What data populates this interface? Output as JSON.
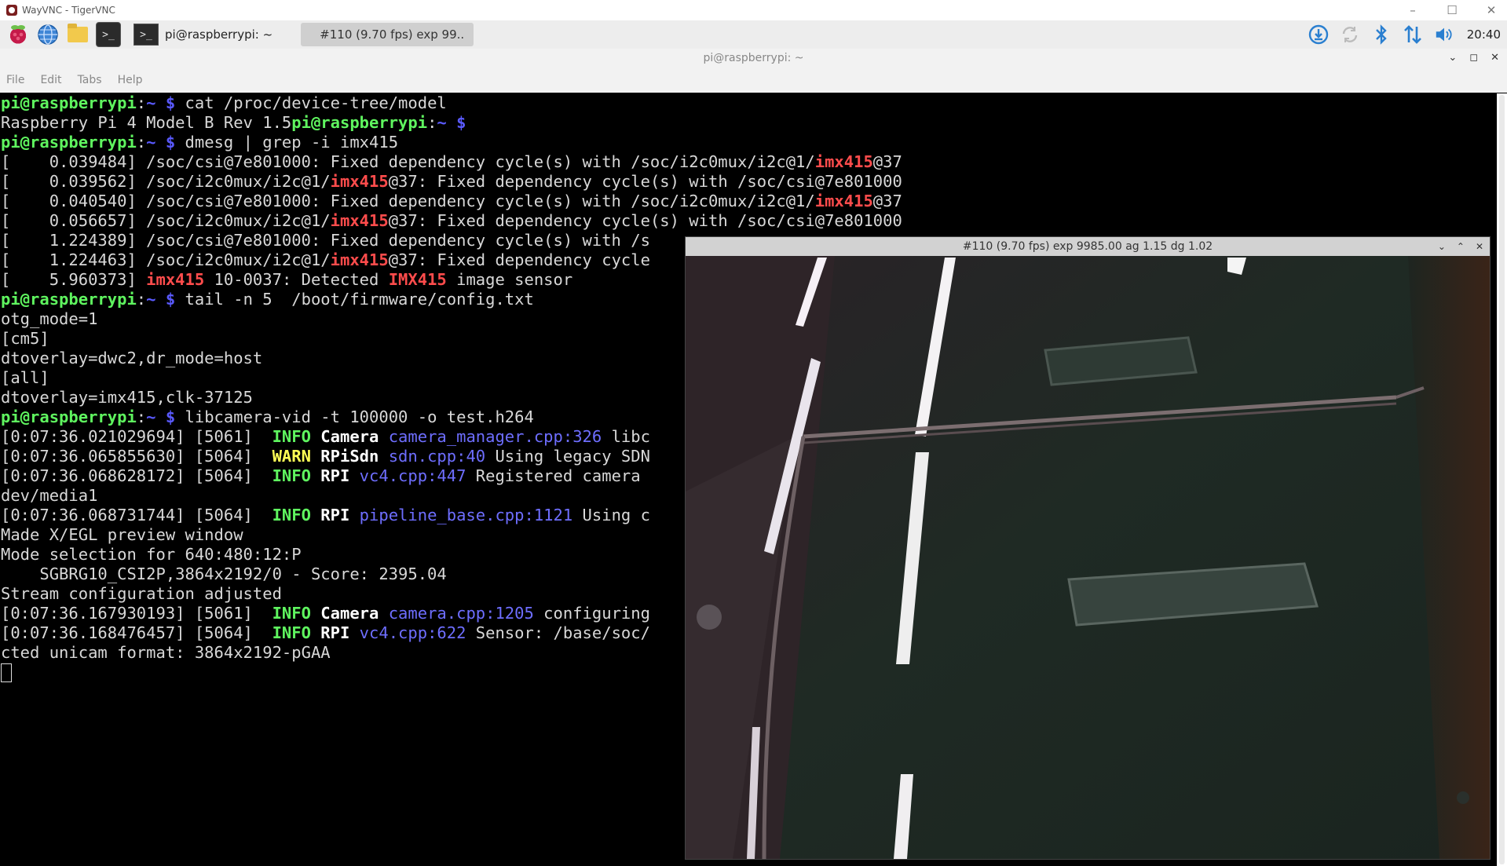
{
  "window": {
    "title": "WayVNC - TigerVNC",
    "controls": [
      "–",
      "☐",
      "✕"
    ]
  },
  "taskbar": {
    "tasks": [
      {
        "label": "pi@raspberrypi: ~",
        "active": false
      },
      {
        "label": "#110 (9.70 fps) exp 99..",
        "active": true
      }
    ],
    "clock": "20:40"
  },
  "terminal_window": {
    "title": "pi@raspberrypi: ~",
    "menu": [
      "File",
      "Edit",
      "Tabs",
      "Help"
    ]
  },
  "terminal": {
    "lines": [
      [
        [
          "u",
          "pi@raspberrypi"
        ],
        [
          "t",
          ":"
        ],
        [
          "p",
          "~ $"
        ],
        [
          "t",
          " cat /proc/device-tree/model"
        ]
      ],
      [
        [
          "t",
          "Raspberry Pi 4 Model B Rev 1.5"
        ],
        [
          "u",
          "pi@raspberrypi"
        ],
        [
          "t",
          ":"
        ],
        [
          "p",
          "~ $"
        ]
      ],
      [
        [
          "u",
          "pi@raspberrypi"
        ],
        [
          "t",
          ":"
        ],
        [
          "p",
          "~ $"
        ],
        [
          "t",
          " dmesg | grep -i imx415"
        ]
      ],
      [
        [
          "t",
          "[    0.039484] /soc/csi@7e801000: Fixed dependency cycle(s) with /soc/i2c0mux/i2c@1/"
        ],
        [
          "r",
          "imx415"
        ],
        [
          "t",
          "@37"
        ]
      ],
      [
        [
          "t",
          "[    0.039562] /soc/i2c0mux/i2c@1/"
        ],
        [
          "r",
          "imx415"
        ],
        [
          "t",
          "@37: Fixed dependency cycle(s) with /soc/csi@7e801000"
        ]
      ],
      [
        [
          "t",
          "[    0.040540] /soc/csi@7e801000: Fixed dependency cycle(s) with /soc/i2c0mux/i2c@1/"
        ],
        [
          "r",
          "imx415"
        ],
        [
          "t",
          "@37"
        ]
      ],
      [
        [
          "t",
          "[    0.056657] /soc/i2c0mux/i2c@1/"
        ],
        [
          "r",
          "imx415"
        ],
        [
          "t",
          "@37: Fixed dependency cycle(s) with /soc/csi@7e801000"
        ]
      ],
      [
        [
          "t",
          "[    1.224389] /soc/csi@7e801000: Fixed dependency cycle(s) with /s"
        ]
      ],
      [
        [
          "t",
          "[    1.224463] /soc/i2c0mux/i2c@1/"
        ],
        [
          "r",
          "imx415"
        ],
        [
          "t",
          "@37: Fixed dependency cycle"
        ]
      ],
      [
        [
          "t",
          "[    5.960373] "
        ],
        [
          "r",
          "imx415"
        ],
        [
          "t",
          " 10-0037: Detected "
        ],
        [
          "r",
          "IMX415"
        ],
        [
          "t",
          " image sensor"
        ]
      ],
      [
        [
          "u",
          "pi@raspberrypi"
        ],
        [
          "t",
          ":"
        ],
        [
          "p",
          "~ $"
        ],
        [
          "t",
          " tail -n 5  /boot/firmware/config.txt"
        ]
      ],
      [
        [
          "t",
          "otg_mode=1"
        ]
      ],
      [
        [
          "t",
          "[cm5]"
        ]
      ],
      [
        [
          "t",
          "dtoverlay=dwc2,dr_mode=host"
        ]
      ],
      [
        [
          "t",
          "[all]"
        ]
      ],
      [
        [
          "t",
          "dtoverlay=imx415,clk-37125"
        ]
      ],
      [
        [
          "u",
          "pi@raspberrypi"
        ],
        [
          "t",
          ":"
        ],
        [
          "p",
          "~ $"
        ],
        [
          "t",
          " libcamera-vid -t 100000 -o test.h264"
        ]
      ],
      [
        [
          "t",
          "[0:07:36.021029694] [5061]  "
        ],
        [
          "i",
          "INFO"
        ],
        [
          "t",
          " "
        ],
        [
          "b",
          "Camera"
        ],
        [
          "t",
          " "
        ],
        [
          "l",
          "camera_manager.cpp:326"
        ],
        [
          "t",
          " libc"
        ]
      ],
      [
        [
          "t",
          "[0:07:36.065855630] [5064]  "
        ],
        [
          "w",
          "WARN"
        ],
        [
          "t",
          " "
        ],
        [
          "b",
          "RPiSdn"
        ],
        [
          "t",
          " "
        ],
        [
          "l",
          "sdn.cpp:40"
        ],
        [
          "t",
          " Using legacy SDN"
        ]
      ],
      [
        [
          "t",
          "[0:07:36.068628172] [5064]  "
        ],
        [
          "i",
          "INFO"
        ],
        [
          "t",
          " "
        ],
        [
          "b",
          "RPI"
        ],
        [
          "t",
          " "
        ],
        [
          "l",
          "vc4.cpp:447"
        ],
        [
          "t",
          " Registered camera"
        ]
      ],
      [
        [
          "t",
          "dev/media1"
        ]
      ],
      [
        [
          "t",
          "[0:07:36.068731744] [5064]  "
        ],
        [
          "i",
          "INFO"
        ],
        [
          "t",
          " "
        ],
        [
          "b",
          "RPI"
        ],
        [
          "t",
          " "
        ],
        [
          "l",
          "pipeline_base.cpp:1121"
        ],
        [
          "t",
          " Using c"
        ]
      ],
      [
        [
          "t",
          "Made X/EGL preview window"
        ]
      ],
      [
        [
          "t",
          "Mode selection for 640:480:12:P"
        ]
      ],
      [
        [
          "t",
          "    SGBRG10_CSI2P,3864x2192/0 - Score: 2395.04"
        ]
      ],
      [
        [
          "t",
          "Stream configuration adjusted"
        ]
      ],
      [
        [
          "t",
          "[0:07:36.167930193] [5061]  "
        ],
        [
          "i",
          "INFO"
        ],
        [
          "t",
          " "
        ],
        [
          "b",
          "Camera"
        ],
        [
          "t",
          " "
        ],
        [
          "l",
          "camera.cpp:1205"
        ],
        [
          "t",
          " configuring"
        ]
      ],
      [
        [
          "t",
          "[0:07:36.168476457] [5064]  "
        ],
        [
          "i",
          "INFO"
        ],
        [
          "t",
          " "
        ],
        [
          "b",
          "RPI"
        ],
        [
          "t",
          " "
        ],
        [
          "l",
          "vc4.cpp:622"
        ],
        [
          "t",
          " Sensor: /base/soc/"
        ]
      ],
      [
        [
          "t",
          "cted unicam format: 3864x2192-pGAA"
        ]
      ]
    ]
  },
  "preview": {
    "title": "#110 (9.70 fps) exp 9985.00 ag 1.15 dg 1.02",
    "controls": [
      "⌄",
      "⌃",
      "✕"
    ]
  },
  "icons": {
    "raspberry": "raspberry-pi-menu-icon",
    "globe": "web-browser-icon",
    "folder": "file-manager-icon",
    "terminal": "terminal-icon",
    "update": "download-updates-icon",
    "sync": "sync-icon",
    "bluetooth": "bluetooth-icon",
    "network": "network-icon",
    "volume": "volume-icon"
  }
}
